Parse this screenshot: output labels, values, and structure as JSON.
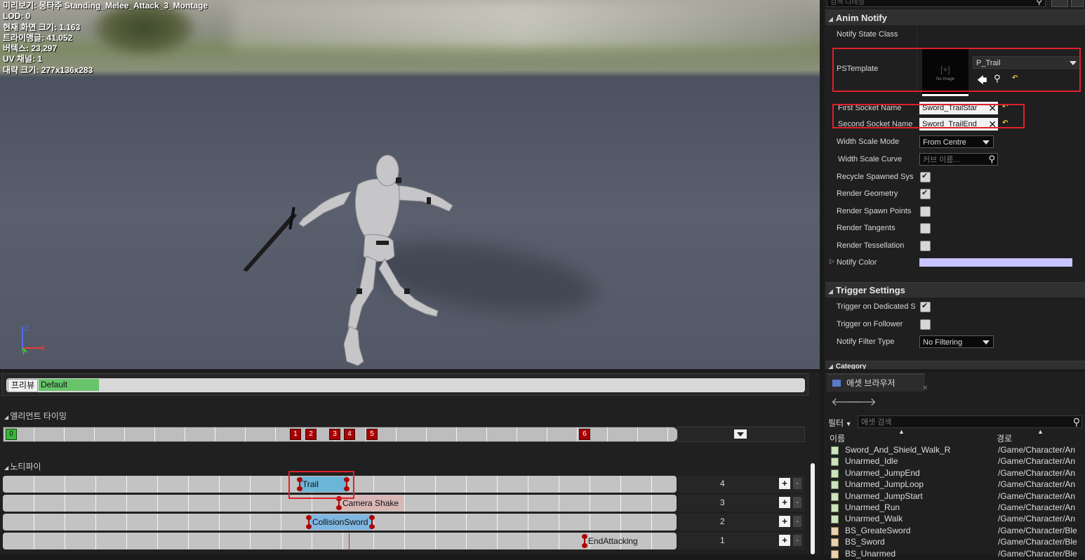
{
  "viewport": {
    "info_lines": [
      "미리보기: 몽타주 Standing_Melee_Attack_3_Montage",
      "LOD: 0",
      "현재 화면 크기: 1.163",
      "트라이앵글: 41,052",
      "버텍스: 23,297",
      "UV 채널: 1",
      "대략 크기: 277x136x283"
    ],
    "axis_labels": {
      "z": "Z",
      "y": "Y",
      "x": "X"
    }
  },
  "details": {
    "search_placeholder": "검색 디테일",
    "anim_notify_header": "Anim Notify",
    "trigger_settings_header": "Trigger Settings",
    "categories_header": "Category",
    "properties": {
      "notify_state_class": "Notify State Class",
      "ps_template": "PSTemplate",
      "ps_template_value": "P_Trail",
      "thumbnail_text": "No Image",
      "first_socket_name": "First Socket Name",
      "first_socket_value": "Sword_TrailStar",
      "second_socket_name": "Second Socket Name",
      "second_socket_value": "Sword_TrailEnd",
      "width_scale_mode": "Width Scale Mode",
      "width_scale_mode_value": "From Centre",
      "width_scale_curve": "Width Scale Curve",
      "width_scale_curve_placeholder": "커브 이름...",
      "recycle_spawned": "Recycle Spawned Sys",
      "render_geometry": "Render Geometry",
      "render_spawn_points": "Render Spawn Points",
      "render_tangents": "Render Tangents",
      "render_tessellation": "Render Tessellation",
      "notify_color": "Notify Color",
      "trigger_on_dedicated": "Trigger on Dedicated S",
      "trigger_on_follower": "Trigger on Follower",
      "notify_filter_type": "Notify Filter Type",
      "notify_filter_value": "No Filtering"
    },
    "checks": {
      "recycle_spawned": true,
      "render_geometry": true,
      "render_spawn_points": false,
      "render_tangents": false,
      "render_tessellation": false,
      "trigger_on_dedicated": true,
      "trigger_on_follower": false
    },
    "colors": {
      "notify_color": "#c8c4ff",
      "highlight": "#e0202a"
    }
  },
  "montage": {
    "preview_button": "프리뷰",
    "default_section": "Default",
    "element_timing_label": "엘리먼트 타이밍",
    "timing_markers": [
      "0",
      "1",
      "2",
      "3",
      "4",
      "5",
      "6"
    ],
    "notifies_label": "노티파이",
    "notify_tracks": [
      {
        "track_number": "4",
        "notify": "Trail"
      },
      {
        "track_number": "3",
        "notify": "Camera Shake"
      },
      {
        "track_number": "2",
        "notify": "CollisionSword"
      },
      {
        "track_number": "1",
        "notify": "EndAttacking"
      }
    ],
    "plus": "+",
    "minus": "-"
  },
  "assets": {
    "tab_title": "애셋 브라우저",
    "filter_label": "필터",
    "search_placeholder": "애셋 검색",
    "col_name": "이름",
    "col_path": "경로",
    "items": [
      {
        "name": "Sword_And_Shield_Walk_R",
        "path": "/Game/Character/An"
      },
      {
        "name": "Unarmed_Idle",
        "path": "/Game/Character/An"
      },
      {
        "name": "Unarmed_JumpEnd",
        "path": "/Game/Character/An"
      },
      {
        "name": "Unarmed_JumpLoop",
        "path": "/Game/Character/An"
      },
      {
        "name": "Unarmed_JumpStart",
        "path": "/Game/Character/An"
      },
      {
        "name": "Unarmed_Run",
        "path": "/Game/Character/An"
      },
      {
        "name": "Unarmed_Walk",
        "path": "/Game/Character/An"
      },
      {
        "name": "BS_GreateSword",
        "path": "/Game/Character/Ble"
      },
      {
        "name": "BS_Sword",
        "path": "/Game/Character/Ble"
      },
      {
        "name": "BS_Unarmed",
        "path": "/Game/Character/Ble"
      }
    ]
  }
}
